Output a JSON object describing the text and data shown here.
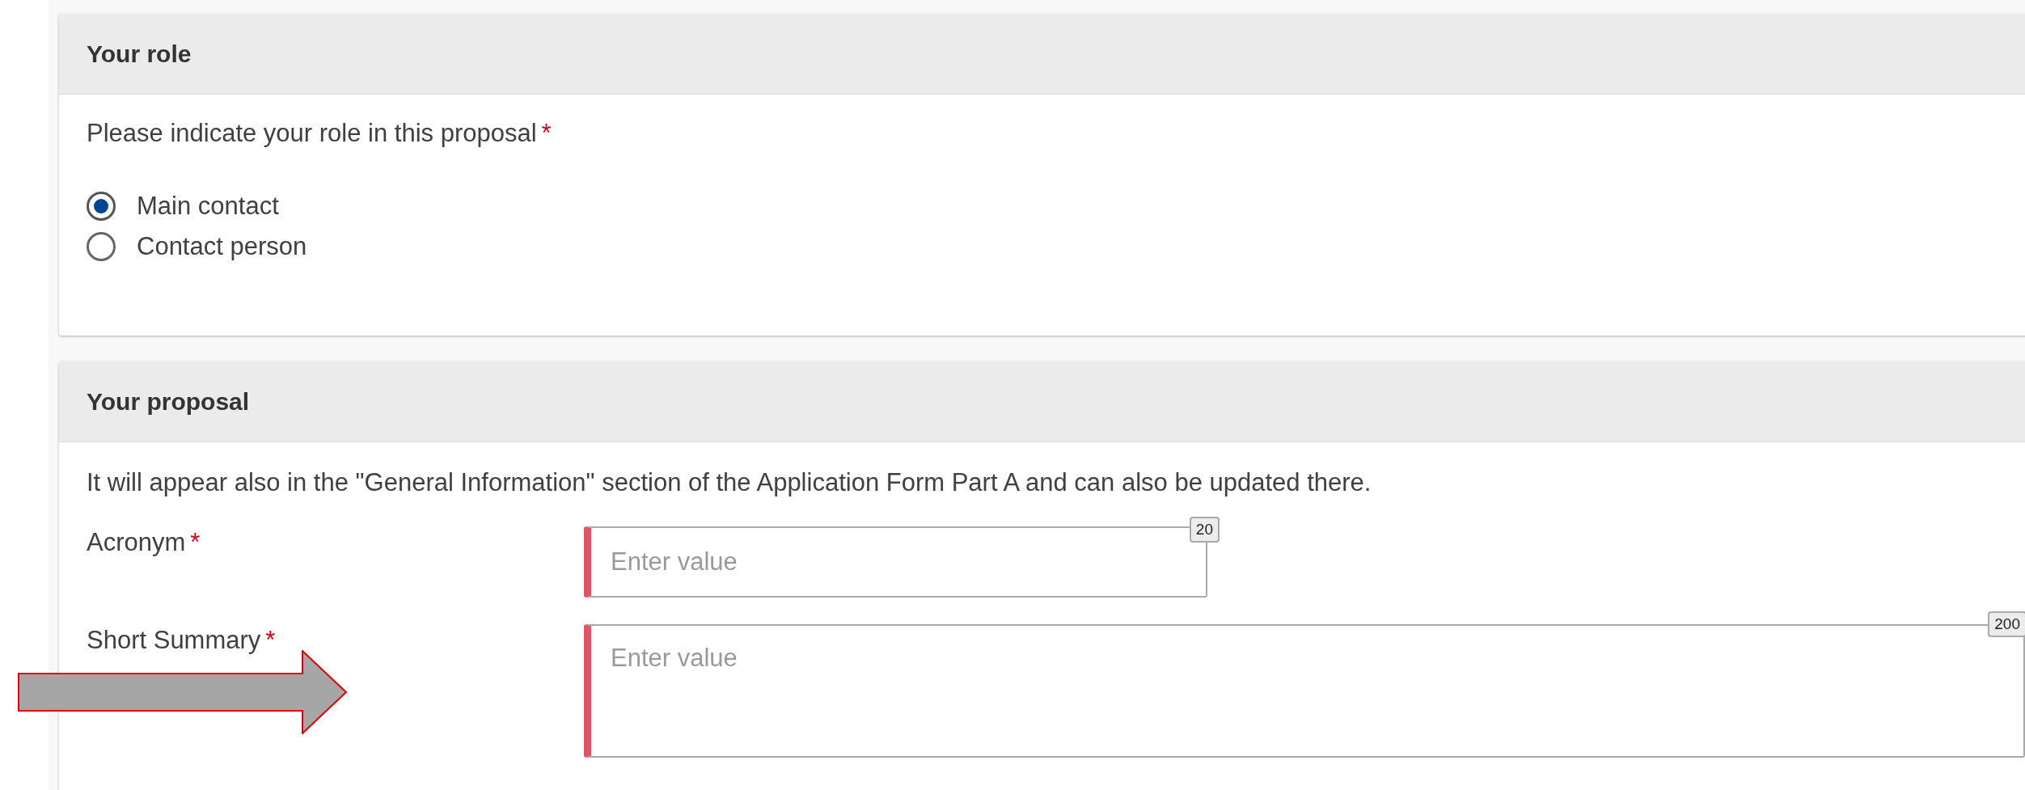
{
  "sections": [
    {
      "title": "Your role",
      "question": {
        "label": "Please indicate your role in this proposal",
        "required_mark": "*"
      },
      "options": [
        {
          "label": "Main contact",
          "selected": true
        },
        {
          "label": "Contact person",
          "selected": false
        }
      ]
    },
    {
      "title": "Your proposal",
      "description": "It will appear also in the \"General Information\" section of the Application Form Part A and can also be updated there.",
      "fields": [
        {
          "kind": "input",
          "label": "Acronym",
          "required_mark": "*",
          "placeholder": "Enter value",
          "counter": "20",
          "invalid": true
        },
        {
          "kind": "textarea",
          "label": "Short Summary",
          "required_mark": "*",
          "placeholder": "Enter value",
          "counter": "200",
          "invalid": true
        }
      ]
    }
  ]
}
